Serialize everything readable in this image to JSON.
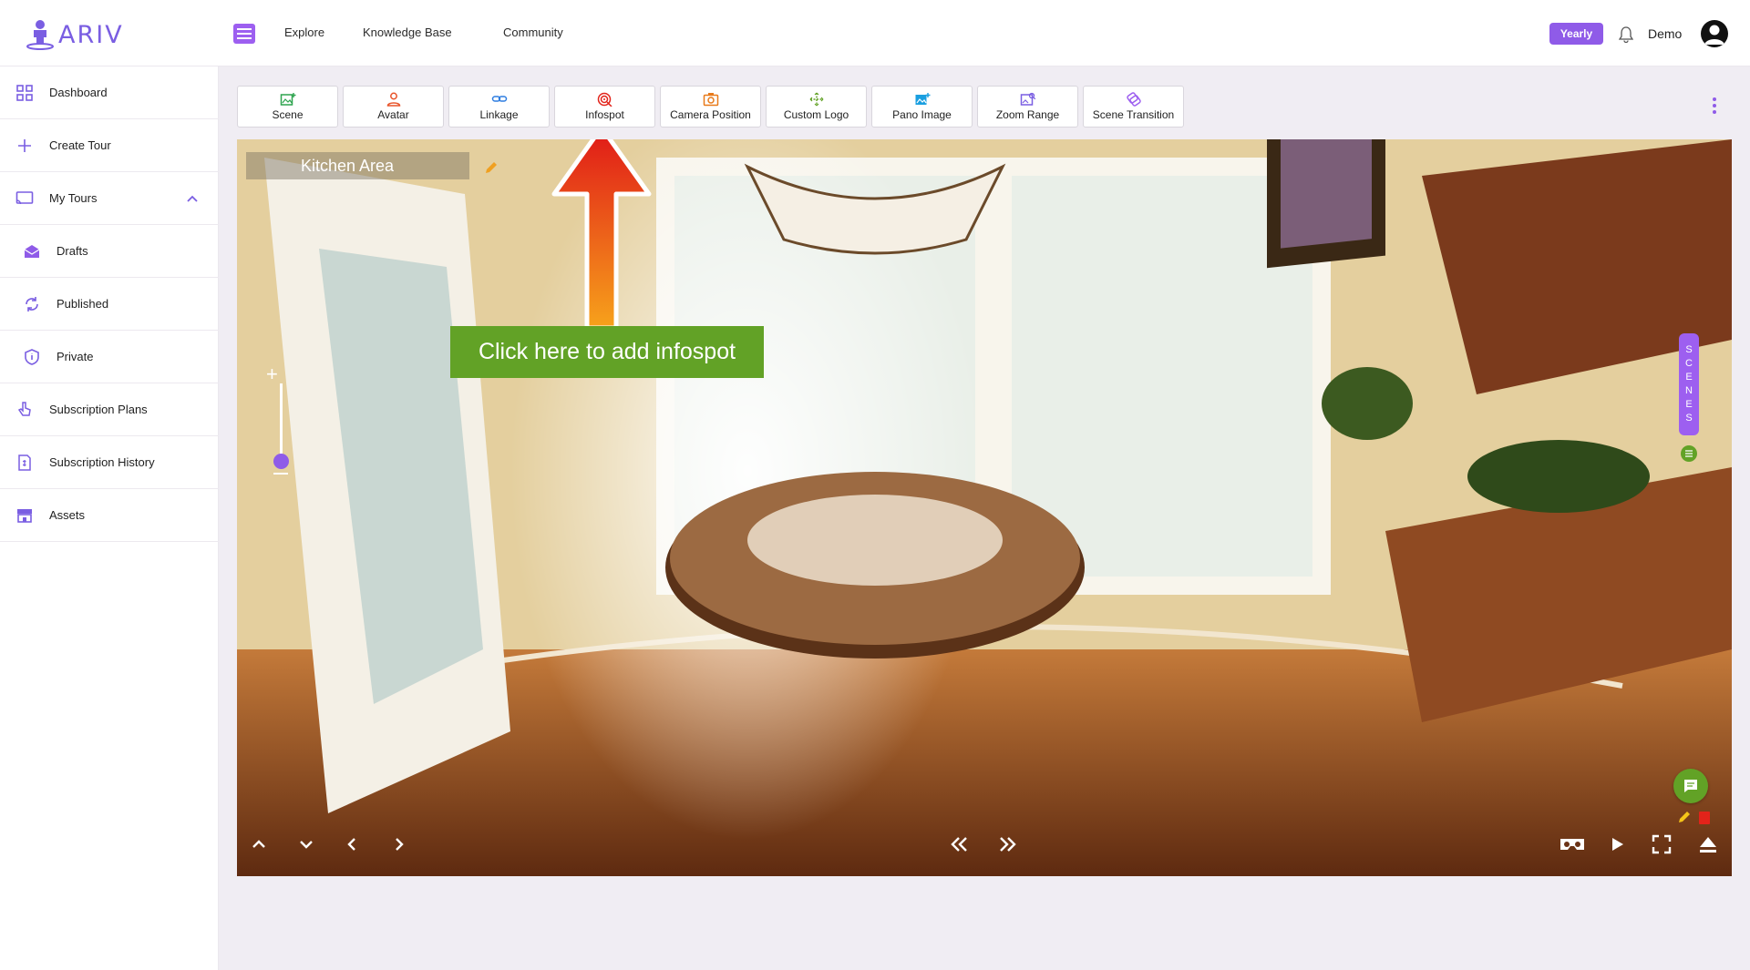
{
  "app": {
    "logo_text": "ARIV"
  },
  "header": {
    "nav": [
      "Explore",
      "Knowledge Base",
      "Community"
    ],
    "plan_badge": "Yearly",
    "user_name": "Demo"
  },
  "sidebar": {
    "items": [
      {
        "label": "Dashboard",
        "icon": "grid-icon"
      },
      {
        "label": "Create Tour",
        "icon": "plus-icon"
      },
      {
        "label": "My Tours",
        "icon": "cast-icon"
      },
      {
        "label": "Drafts",
        "icon": "envelope-icon"
      },
      {
        "label": "Published",
        "icon": "sync-icon"
      },
      {
        "label": "Private",
        "icon": "shield-icon"
      },
      {
        "label": "Subscription Plans",
        "icon": "hand-pointer-icon"
      },
      {
        "label": "Subscription History",
        "icon": "receipt-icon"
      },
      {
        "label": "Assets",
        "icon": "store-icon"
      }
    ]
  },
  "toolbar": {
    "tools": [
      {
        "label": "Scene",
        "color": "#2ea44f"
      },
      {
        "label": "Avatar",
        "color": "#e8542a"
      },
      {
        "label": "Linkage",
        "color": "#2e7de0"
      },
      {
        "label": "Infospot",
        "color": "#e2231a"
      },
      {
        "label": "Camera Position",
        "color": "#e87a1a"
      },
      {
        "label": "Custom Logo",
        "color": "#62a226"
      },
      {
        "label": "Pano Image",
        "color": "#1a9fe0"
      },
      {
        "label": "Zoom Range",
        "color": "#7a5ee2"
      },
      {
        "label": "Scene Transition",
        "color": "#9d5ff0"
      }
    ]
  },
  "viewer": {
    "scene_title": "Kitchen Area",
    "callout": "Click here to add infospot",
    "scenes_tab_letters": [
      "S",
      "C",
      "E",
      "N",
      "E",
      "S"
    ]
  },
  "colors": {
    "accent": "#8f5be8",
    "green": "#62a226"
  }
}
